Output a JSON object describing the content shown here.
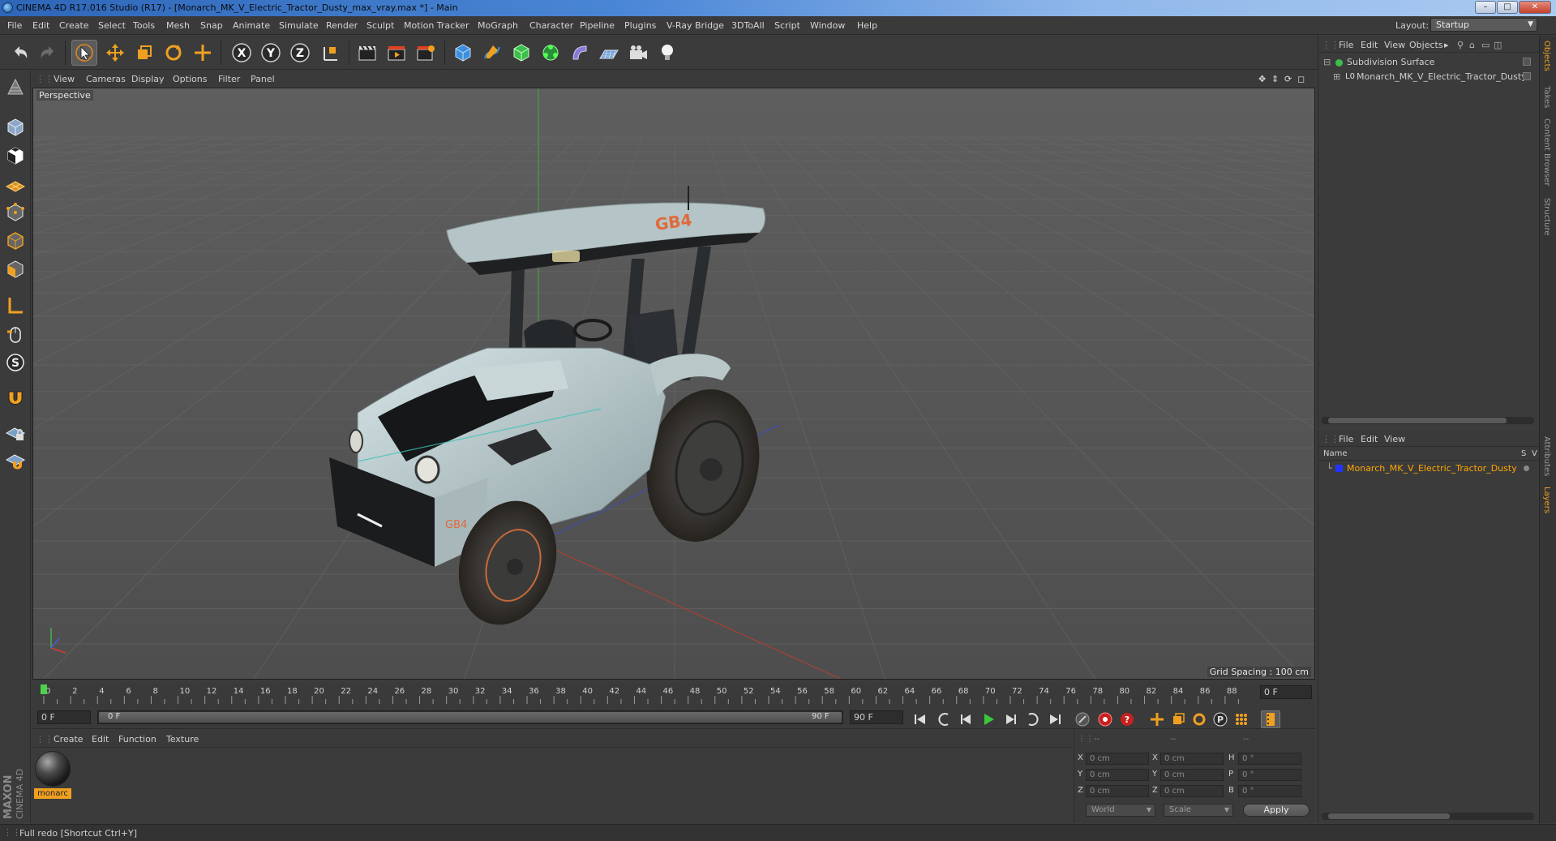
{
  "window": {
    "title": "CINEMA 4D R17.016 Studio (R17) - [Monarch_MK_V_Electric_Tractor_Dusty_max_vray.max *] - Main",
    "controls": {
      "minimize": "–",
      "maximize": "□",
      "close": "✕"
    }
  },
  "menubar": {
    "items": [
      "File",
      "Edit",
      "Create",
      "Select",
      "Tools",
      "Mesh",
      "Snap",
      "Animate",
      "Simulate",
      "Render",
      "Sculpt",
      "Motion Tracker",
      "MoGraph",
      "Character",
      "Pipeline",
      "Plugins",
      "V-Ray Bridge",
      "3DToAll",
      "Script",
      "Window",
      "Help"
    ],
    "layout_label": "Layout:",
    "layout_value": "Startup"
  },
  "viewport": {
    "menu": [
      "View",
      "Cameras",
      "Display",
      "Options",
      "Filter",
      "Panel"
    ],
    "label": "Perspective",
    "grid_spacing": "Grid Spacing : 100 cm",
    "model_decal": "GB4"
  },
  "timeline": {
    "ticks": [
      "0",
      "2",
      "4",
      "6",
      "8",
      "10",
      "12",
      "14",
      "16",
      "18",
      "20",
      "22",
      "24",
      "26",
      "28",
      "30",
      "32",
      "34",
      "36",
      "38",
      "40",
      "42",
      "44",
      "46",
      "48",
      "50",
      "52",
      "54",
      "56",
      "58",
      "60",
      "62",
      "64",
      "66",
      "68",
      "70",
      "72",
      "74",
      "76",
      "78",
      "80",
      "82",
      "84",
      "86",
      "88",
      "90"
    ],
    "current_frame": "0 F",
    "start_field": "0 F",
    "range_start": "0 F",
    "range_end": "90 F",
    "end_field": "90 F"
  },
  "material_manager": {
    "menu": [
      "Create",
      "Edit",
      "Function",
      "Texture"
    ],
    "materials": [
      {
        "name": "monarc"
      }
    ]
  },
  "coordinates": {
    "header": [
      "--",
      "--",
      "--"
    ],
    "rows": [
      {
        "axis": "X",
        "pos": "0 cm",
        "saxis": "X",
        "size": "0 cm",
        "raxis": "H",
        "rot": "0 °"
      },
      {
        "axis": "Y",
        "pos": "0 cm",
        "saxis": "Y",
        "size": "0 cm",
        "raxis": "P",
        "rot": "0 °"
      },
      {
        "axis": "Z",
        "pos": "0 cm",
        "saxis": "Z",
        "size": "0 cm",
        "raxis": "B",
        "rot": "0 °"
      }
    ],
    "mode_world": "World",
    "mode_scale": "Scale",
    "apply": "Apply"
  },
  "object_manager": {
    "menu": [
      "File",
      "Edit",
      "View",
      "Objects"
    ],
    "objects": [
      "Subdivision Surface",
      "Monarch_MK_V_Electric_Tractor_Dusty"
    ]
  },
  "layer_manager": {
    "menu": [
      "File",
      "Edit",
      "View"
    ],
    "col_name": "Name",
    "col_s": "S",
    "col_v": "V",
    "layers": [
      "Monarch_MK_V_Electric_Tractor_Dusty"
    ]
  },
  "right_tabs": [
    "Objects",
    "Takes",
    "Content Browser",
    "Structure",
    "Attributes",
    "Layers"
  ],
  "status": {
    "text": "Full redo [Shortcut Ctrl+Y]"
  },
  "logo": {
    "line1": "MAXON",
    "line2": "CINEMA 4D"
  },
  "colors": {
    "accent": "#f0a020",
    "layer_color": "#2233ff",
    "selection": "#ffa500"
  }
}
